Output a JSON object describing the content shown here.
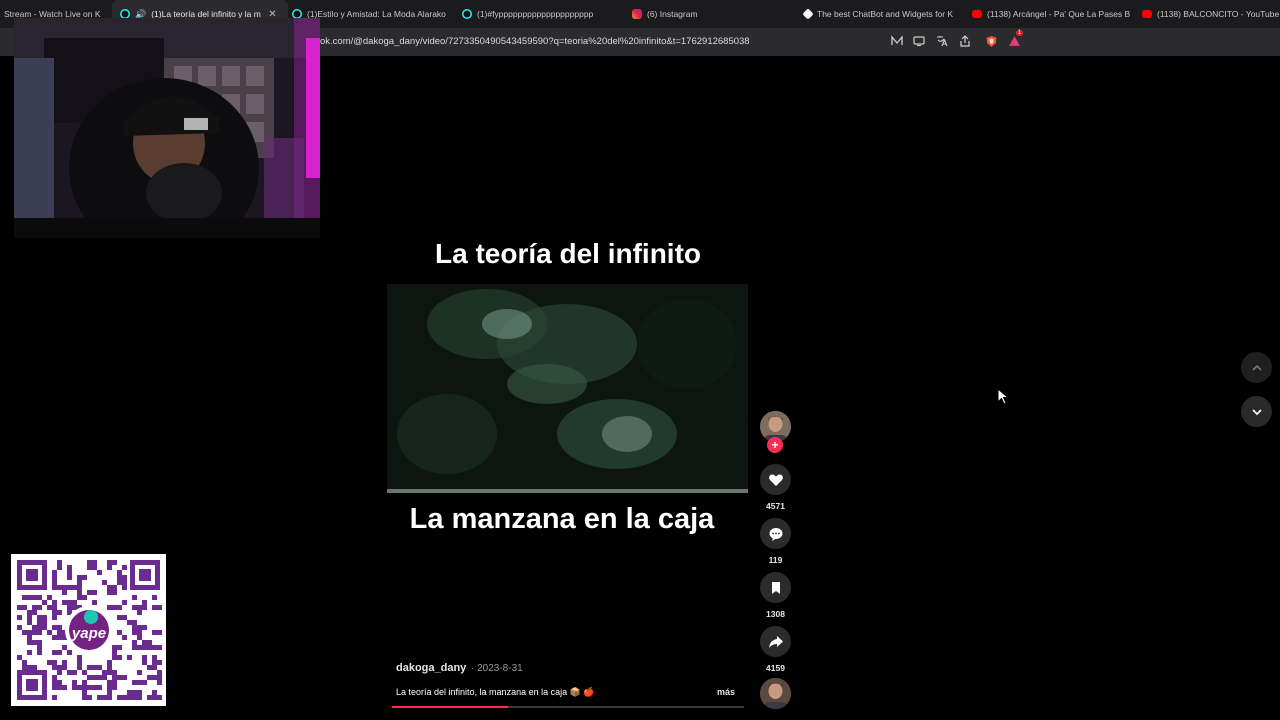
{
  "browser": {
    "tabs": [
      {
        "label": "Stream - Watch Live on K",
        "icon": "kick-icon",
        "active": false
      },
      {
        "label": "(1)La teoría del infinito y la m",
        "icon": "tiktok-icon",
        "active": true
      },
      {
        "label": "(1)Estilo y Amistad: La Moda Alarako",
        "icon": "tiktok-icon",
        "active": false
      },
      {
        "label": "(1)#fypppppppppppppppppppp",
        "icon": "tiktok-icon",
        "active": false
      },
      {
        "label": "(6) Instagram",
        "icon": "instagram-icon",
        "active": false
      },
      {
        "label": "The best ChatBot and Widgets for K",
        "icon": "chatbot-icon",
        "active": false
      },
      {
        "label": "(1138) Arcángel - Pa' Que La Pases B",
        "icon": "youtube-icon",
        "active": false
      },
      {
        "label": "(1138) BALCONCITO - YouTube",
        "icon": "youtube-icon",
        "active": false
      }
    ],
    "url": "ok.com/@dakoga_dany/video/7273350490543459590?q=teoria%20del%20infinito&t=1762912685038",
    "extension_badge": "1"
  },
  "video": {
    "title_overlay": "La teoría del infinito",
    "subtitle_overlay": "La manzana en la caja",
    "author": "dakoga_dany",
    "date": "· 2023-8-31",
    "caption": "La teoría del infinito, la manzana en la caja 📦 🍎",
    "more_label": "más",
    "progress": 0.33
  },
  "actions": {
    "likes": "4571",
    "comments": "119",
    "saves": "1308",
    "shares": "4159"
  },
  "colors": {
    "accent": "#fe2c55",
    "page_bg": "#000000",
    "tab_bg": "#1b1b1d",
    "action_bg": "#2b2b2b"
  }
}
